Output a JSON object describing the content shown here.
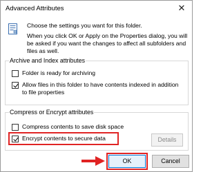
{
  "window": {
    "title": "Advanced Attributes",
    "close_glyph": "✕"
  },
  "intro": {
    "line1": "Choose the settings you want for this folder.",
    "line2": "When you click OK or Apply on the Properties dialog, you will be asked if you want the changes to affect all subfolders and files as well."
  },
  "archive_group": {
    "title": "Archive and Index attributes",
    "archive_label": "Folder is ready for archiving",
    "archive_checked": false,
    "index_label": "Allow files in this folder to have contents indexed in addition to file properties",
    "index_checked": true
  },
  "compress_group": {
    "title": "Compress or Encrypt attributes",
    "compress_label": "Compress contents to save disk space",
    "compress_checked": false,
    "encrypt_label": "Encrypt contents to secure data",
    "encrypt_checked": true,
    "details_label": "Details"
  },
  "buttons": {
    "ok_label": "OK",
    "cancel_label": "Cancel"
  },
  "colors": {
    "highlight": "#e02323",
    "accent": "#0078d7"
  }
}
